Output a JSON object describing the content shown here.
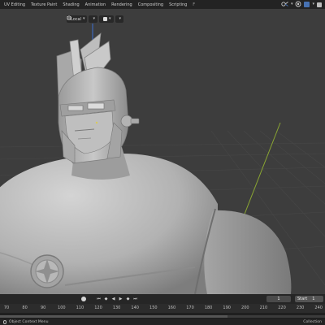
{
  "topbar": {
    "tabs": [
      "UV Editing",
      "Texture Paint",
      "Shading",
      "Animation",
      "Rendering",
      "Compositing",
      "Scripting"
    ],
    "more_label": "F"
  },
  "viewport_header": {
    "orientation_label": "Local",
    "orientation_icon": "transform-orientation-icon",
    "pivot_icon": "pivot-point-icon",
    "snap_icon": "magnet-snap-icon",
    "proportional_icon": "proportional-editing-icon"
  },
  "viewport": {
    "scene_description_icons": [
      "character-bust-model",
      "cursor-3d"
    ],
    "gizmo_colors": {
      "z_axis": "#3c6fd4",
      "y_axis": "#8aa632",
      "x_axis": "#c53a3a"
    }
  },
  "timeline": {
    "current_frame": "1",
    "start_label": "Start",
    "start_value": "1",
    "ruler_ticks": [
      "70",
      "80",
      "90",
      "100",
      "110",
      "120",
      "130",
      "140",
      "150",
      "160",
      "170",
      "180",
      "190",
      "200",
      "210",
      "220",
      "230",
      "240"
    ],
    "playback_icons": [
      "jump-start-icon",
      "prev-keyframe-icon",
      "play-reverse-icon",
      "play-icon",
      "next-keyframe-icon",
      "jump-end-icon"
    ]
  },
  "statusbar": {
    "left": "Object Context Menu",
    "right": "Collection"
  },
  "colors": {
    "background": "#3d3d3d",
    "grid": "#474747",
    "model": "#bdbdbd",
    "accent_blue": "#4772b3"
  }
}
